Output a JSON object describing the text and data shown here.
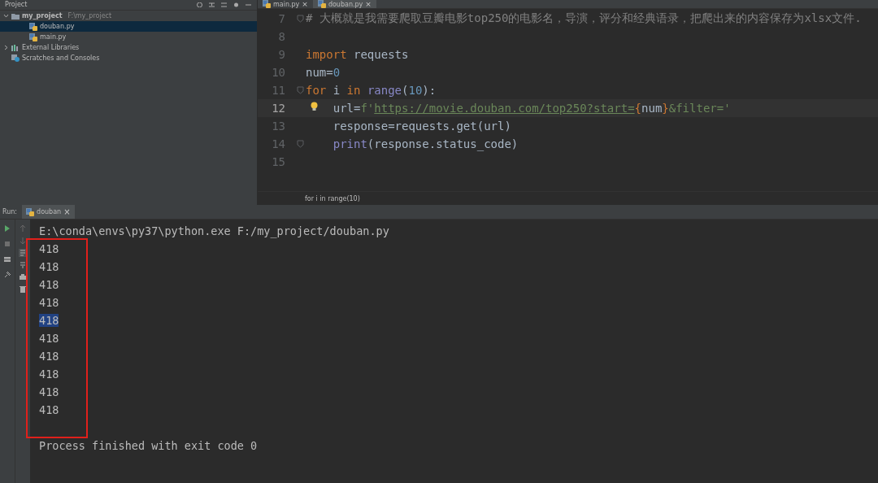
{
  "project_pane": {
    "title": "Project",
    "tree": [
      {
        "label": "my_project",
        "hint": "F:\\my_project",
        "kind": "folder",
        "expanded": true,
        "selected": false,
        "children": [
          {
            "label": "douban.py",
            "kind": "python",
            "selected": true
          },
          {
            "label": "main.py",
            "kind": "python",
            "selected": false
          }
        ]
      },
      {
        "label": "External Libraries",
        "kind": "libraries",
        "expanded": false,
        "selected": false
      },
      {
        "label": "Scratches and Consoles",
        "kind": "scratches",
        "selected": false
      }
    ]
  },
  "editor": {
    "tabs": [
      {
        "label": "main.py",
        "close": "×",
        "selected": false
      },
      {
        "label": "douban.py",
        "close": "×",
        "selected": true
      }
    ],
    "lines": [
      {
        "number": "7",
        "current": false,
        "fold": true,
        "bulb": false,
        "tokens": [
          {
            "kind": "comment",
            "text": "# 大概就是我需要爬取豆瓣电影top250的电影名，导演，评分和经典语录，把爬出来的内容保存为xlsx文件."
          }
        ]
      },
      {
        "number": "8",
        "current": false,
        "fold": false,
        "bulb": false
      },
      {
        "number": "9",
        "current": false,
        "fold": false,
        "bulb": false,
        "tokens": [
          {
            "kind": "keyword",
            "text": "import"
          },
          {
            "kind": "plain",
            "text": " requests"
          }
        ]
      },
      {
        "number": "10",
        "current": false,
        "fold": false,
        "bulb": false,
        "tokens": [
          {
            "kind": "plain",
            "text": "num="
          },
          {
            "kind": "number",
            "text": "0"
          }
        ]
      },
      {
        "number": "11",
        "current": false,
        "fold": true,
        "bulb": false,
        "tokens": [
          {
            "kind": "keyword",
            "text": "for"
          },
          {
            "kind": "plain",
            "text": " i "
          },
          {
            "kind": "keyword",
            "text": "in"
          },
          {
            "kind": "builtin",
            "text": " range"
          },
          {
            "kind": "plain",
            "text": "("
          },
          {
            "kind": "number",
            "text": "10"
          },
          {
            "kind": "plain",
            "text": "):"
          }
        ]
      },
      {
        "number": "12",
        "current": true,
        "fold": false,
        "bulb": true,
        "tokens": [
          {
            "kind": "plain",
            "text": "    url="
          },
          {
            "kind": "string",
            "text": "f'"
          },
          {
            "kind": "url",
            "text": "https://movie.douban.com/top250?start="
          },
          {
            "kind": "brace",
            "text": "{"
          },
          {
            "kind": "plain",
            "text": "num"
          },
          {
            "kind": "brace",
            "text": "}"
          },
          {
            "kind": "string",
            "text": "&filter='"
          }
        ]
      },
      {
        "number": "13",
        "current": false,
        "fold": false,
        "bulb": false,
        "tokens": [
          {
            "kind": "plain",
            "text": "    response=requests.get(url)"
          }
        ]
      },
      {
        "number": "14",
        "current": false,
        "fold": true,
        "bulb": false,
        "tokens": [
          {
            "kind": "builtin",
            "text": "    print"
          },
          {
            "kind": "plain",
            "text": "(response.status_code)"
          }
        ]
      },
      {
        "number": "15",
        "current": false,
        "fold": false,
        "bulb": false
      }
    ],
    "breadcrumb": "for i in range(10)"
  },
  "run_panel": {
    "label": "Run:",
    "tabs": [
      {
        "label": "douban",
        "close": "×",
        "selected": true
      }
    ],
    "command": "E:\\conda\\envs\\py37\\python.exe F:/my_project/douban.py",
    "output": [
      {
        "text": "418",
        "selected": false
      },
      {
        "text": "418",
        "selected": false
      },
      {
        "text": "418",
        "selected": false
      },
      {
        "text": "418",
        "selected": false
      },
      {
        "text": "418",
        "selected": true
      },
      {
        "text": "418",
        "selected": false
      },
      {
        "text": "418",
        "selected": false
      },
      {
        "text": "418",
        "selected": false
      },
      {
        "text": "418",
        "selected": false
      },
      {
        "text": "418",
        "selected": false
      }
    ],
    "status": "Process finished with exit code 0"
  }
}
